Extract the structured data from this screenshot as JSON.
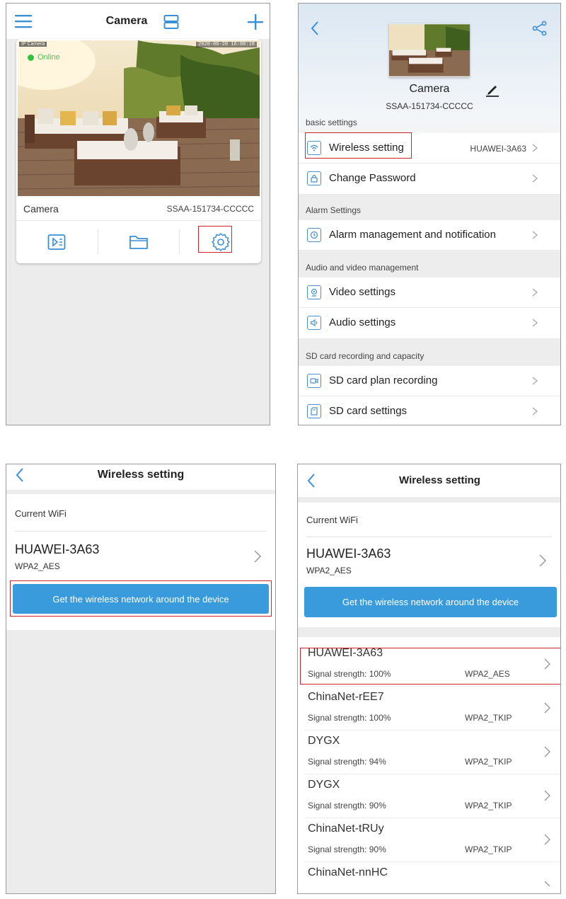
{
  "camera_list": {
    "title": "Camera",
    "card": {
      "status": "Online",
      "overlay_tag": "IP Camera",
      "timestamp": "2020-06-20 16:08:18",
      "name": "Camera",
      "device_id": "SSAA-151734-CCCCC"
    },
    "icons": {
      "menu": "menu-icon",
      "layout": "layout-toggle-icon",
      "add": "plus-icon",
      "playback": "playback-icon",
      "folder": "folder-icon",
      "settings": "gear-icon"
    }
  },
  "settings": {
    "camera_name": "Camera",
    "device_id": "SSAA-151734-CCCCC",
    "sections": {
      "basic": "basic settings",
      "alarm": "Alarm Settings",
      "av": "Audio and video management",
      "sd": "SD card recording and capacity"
    },
    "rows": {
      "wireless": {
        "label": "Wireless setting",
        "value": "HUAWEI-3A63"
      },
      "password": {
        "label": "Change Password"
      },
      "alarm": {
        "label": "Alarm management and notification"
      },
      "video": {
        "label": "Video settings"
      },
      "audio": {
        "label": "Audio settings"
      },
      "sd_plan": {
        "label": "SD card plan recording"
      },
      "sd_settings": {
        "label": "SD card settings"
      }
    }
  },
  "wireless": {
    "title": "Wireless setting",
    "current_label": "Current WiFi",
    "current_ssid": "HUAWEI-3A63",
    "current_enc": "WPA2_AES",
    "scan_button": "Get the wireless network around the device"
  },
  "wireless_scan": {
    "title": "Wireless setting",
    "current_label": "Current WiFi",
    "current_ssid": "HUAWEI-3A63",
    "current_enc": "WPA2_AES",
    "scan_button": "Get the wireless network around the device",
    "networks": [
      {
        "ssid": "HUAWEI-3A63",
        "signal": "Signal strength: 100%",
        "enc": "WPA2_AES"
      },
      {
        "ssid": "ChinaNet-rEE7",
        "signal": "Signal strength: 100%",
        "enc": "WPA2_TKIP"
      },
      {
        "ssid": "DYGX",
        "signal": "Signal strength: 94%",
        "enc": "WPA2_TKIP"
      },
      {
        "ssid": "DYGX",
        "signal": "Signal strength: 90%",
        "enc": "WPA2_TKIP"
      },
      {
        "ssid": "ChinaNet-tRUy",
        "signal": "Signal strength: 90%",
        "enc": "WPA2_TKIP"
      },
      {
        "ssid": "ChinaNet-nnHC",
        "signal": "",
        "enc": ""
      }
    ]
  },
  "colors": {
    "accent": "#3a9bdc",
    "online": "#31c43e",
    "highlight_border": "#c8262b",
    "icon_blue": "#4a90d0"
  }
}
